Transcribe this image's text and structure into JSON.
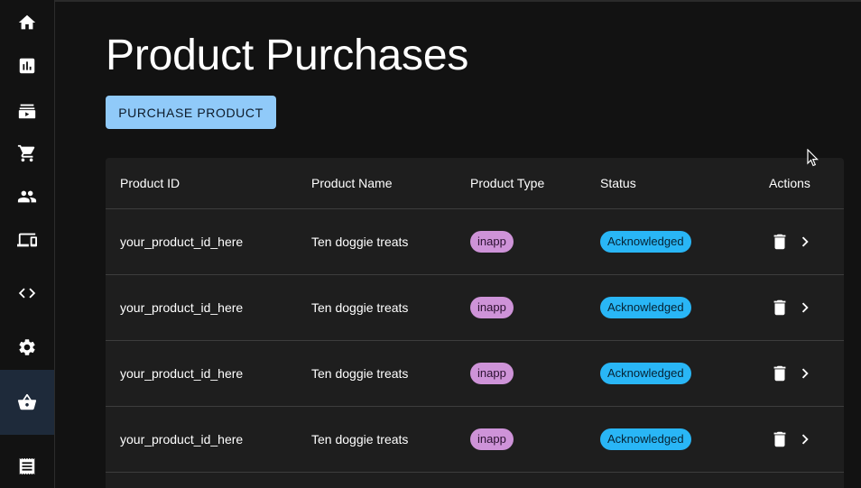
{
  "sidebar": {
    "items": [
      {
        "icon": "home-icon"
      },
      {
        "icon": "bar-chart-icon"
      },
      {
        "icon": "video-library-icon"
      },
      {
        "icon": "shopping-cart-icon"
      },
      {
        "icon": "people-icon"
      },
      {
        "icon": "devices-icon"
      },
      {
        "icon": "code-icon"
      },
      {
        "icon": "settings-icon"
      },
      {
        "icon": "shopping-basket-icon",
        "active": true
      },
      {
        "icon": "receipt-icon"
      }
    ]
  },
  "page": {
    "title": "Product Purchases",
    "purchase_button": "PURCHASE PRODUCT"
  },
  "table": {
    "headers": [
      "Product ID",
      "Product Name",
      "Product Type",
      "Status",
      "Actions"
    ],
    "rows": [
      {
        "product_id": "your_product_id_here",
        "product_name": "Ten doggie treats",
        "product_type": "inapp",
        "status": "Acknowledged"
      },
      {
        "product_id": "your_product_id_here",
        "product_name": "Ten doggie treats",
        "product_type": "inapp",
        "status": "Acknowledged"
      },
      {
        "product_id": "your_product_id_here",
        "product_name": "Ten doggie treats",
        "product_type": "inapp",
        "status": "Acknowledged"
      },
      {
        "product_id": "your_product_id_here",
        "product_name": "Ten doggie treats",
        "product_type": "inapp",
        "status": "Acknowledged"
      }
    ]
  },
  "colors": {
    "background": "#121212",
    "surface": "#1e1e1e",
    "primary_button": "#90caf9",
    "type_chip": "#ce93d8",
    "status_chip": "#29b6f6",
    "active_nav": "#1e2a3a"
  }
}
